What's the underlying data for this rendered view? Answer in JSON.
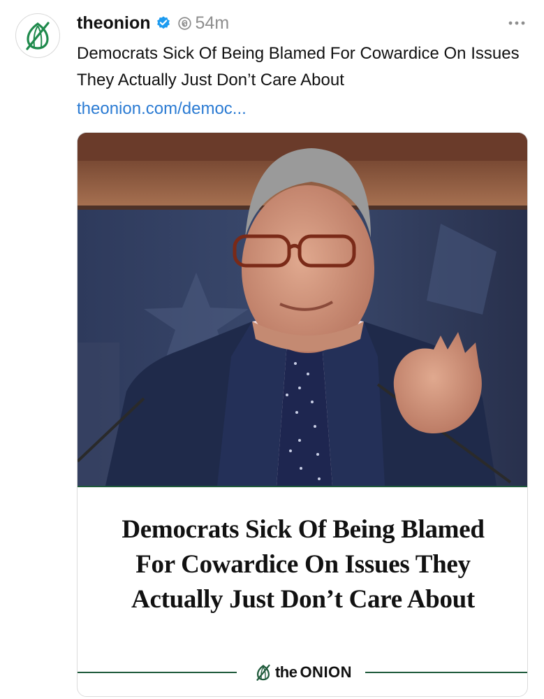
{
  "post": {
    "username": "theonion",
    "timestamp": "54m",
    "text": "Democrats Sick Of Being Blamed For Cowardice On Issues They Actually Just Don’t Care About",
    "link_text": "theonion.com/democ..."
  },
  "card": {
    "headline_lines": [
      "Democrats Sick Of Being Blamed",
      "For Cowardice On Issues They",
      "Actually Just Don’t Care About"
    ],
    "brand_prefix": "the",
    "brand_name": "ONION"
  },
  "icons": {
    "avatar": "onion-logo-icon",
    "verified": "verified-badge-icon",
    "threads": "threads-icon",
    "more": "more-options-icon"
  },
  "colors": {
    "link": "#2b7bd3",
    "verified": "#1d9bf0",
    "onion_green": "#1f5a3b",
    "muted": "#8e8e8e"
  }
}
